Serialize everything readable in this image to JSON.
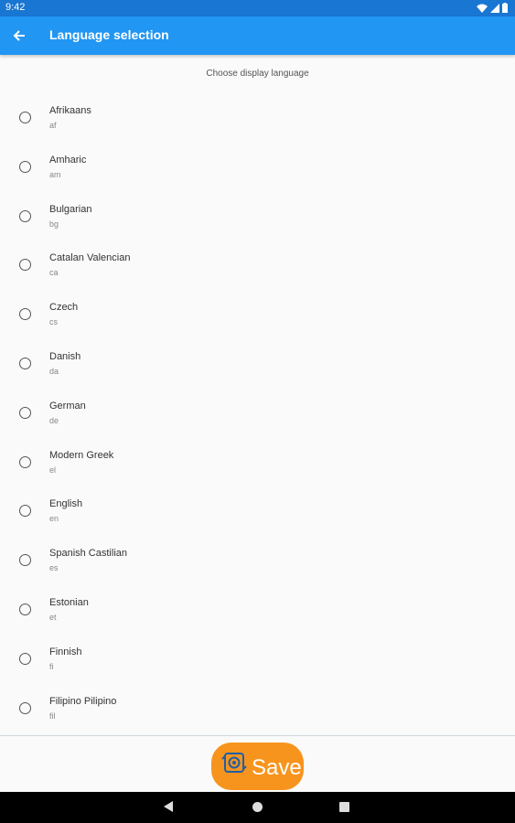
{
  "status_bar": {
    "time": "9:42"
  },
  "app_bar": {
    "title": "Language selection"
  },
  "subtitle": "Choose display language",
  "languages": [
    {
      "name": "Afrikaans",
      "code": "af",
      "selected": false
    },
    {
      "name": "Amharic",
      "code": "am",
      "selected": false
    },
    {
      "name": "Bulgarian",
      "code": "bg",
      "selected": false
    },
    {
      "name": "Catalan Valencian",
      "code": "ca",
      "selected": false
    },
    {
      "name": "Czech",
      "code": "cs",
      "selected": false
    },
    {
      "name": "Danish",
      "code": "da",
      "selected": false
    },
    {
      "name": "German",
      "code": "de",
      "selected": false
    },
    {
      "name": "Modern Greek",
      "code": "el",
      "selected": false
    },
    {
      "name": "English",
      "code": "en",
      "selected": false
    },
    {
      "name": "Spanish Castilian",
      "code": "es",
      "selected": false
    },
    {
      "name": "Estonian",
      "code": "et",
      "selected": false
    },
    {
      "name": "Finnish",
      "code": "fi",
      "selected": false
    },
    {
      "name": "Filipino Pilipino",
      "code": "fil",
      "selected": false
    }
  ],
  "save_button": {
    "label": "Save",
    "icon": "save-settings-icon"
  },
  "colors": {
    "app_bar": "#2196f3",
    "status_bar": "#1976d2",
    "save_button": "#f7941d",
    "nav_bar": "#000000"
  }
}
